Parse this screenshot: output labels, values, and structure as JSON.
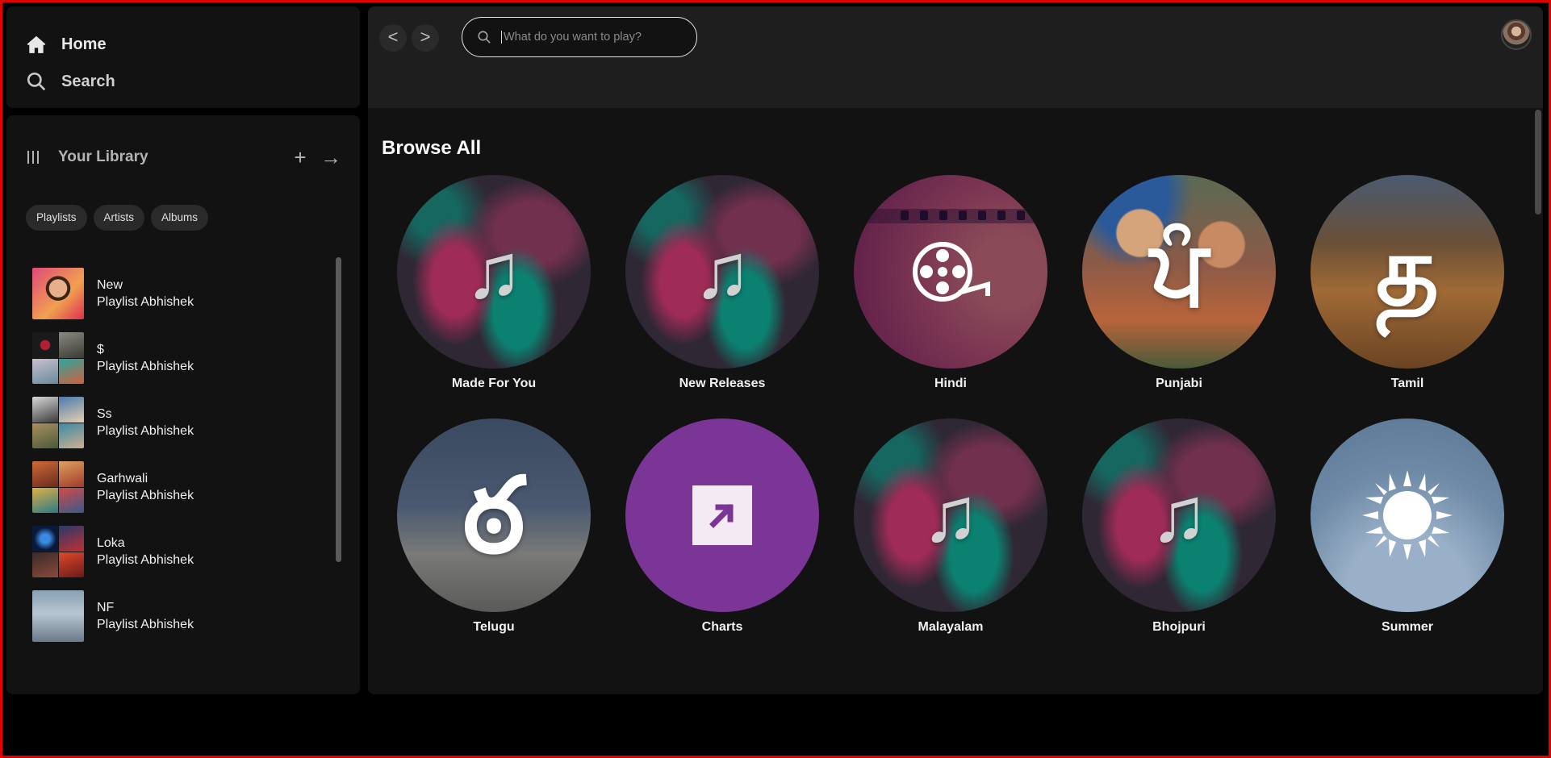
{
  "nav": {
    "home_label": "Home",
    "search_label": "Search"
  },
  "library": {
    "title": "Your Library",
    "add_icon": "+",
    "expand_icon": "→",
    "chips": [
      "Playlists",
      "Artists",
      "Albums"
    ],
    "items": [
      {
        "name": "New",
        "subtitle": "Playlist Abhishek"
      },
      {
        "name": "$",
        "subtitle": "Playlist Abhishek"
      },
      {
        "name": "Ss",
        "subtitle": "Playlist Abhishek"
      },
      {
        "name": "Garhwali",
        "subtitle": "Playlist Abhishek"
      },
      {
        "name": "Loka",
        "subtitle": "Playlist Abhishek"
      },
      {
        "name": "NF",
        "subtitle": "Playlist Abhishek"
      }
    ]
  },
  "topbar": {
    "back_label": "<",
    "forward_label": ">",
    "search_placeholder": "What do you want to play?"
  },
  "browse": {
    "title": "Browse All",
    "cards": [
      {
        "label": "Made For You",
        "glyph": "♫"
      },
      {
        "label": "New Releases",
        "glyph": "♫"
      },
      {
        "label": "Hindi",
        "glyph": ""
      },
      {
        "label": "Punjabi",
        "glyph": "ਪੰ"
      },
      {
        "label": "Tamil",
        "glyph": "த"
      },
      {
        "label": "Telugu",
        "glyph": "ఠ"
      },
      {
        "label": "Charts",
        "glyph": ""
      },
      {
        "label": "Malayalam",
        "glyph": "♫"
      },
      {
        "label": "Bhojpuri",
        "glyph": "♫"
      },
      {
        "label": "Summer",
        "glyph": ""
      }
    ]
  },
  "colors": {
    "panel": "#121212",
    "topbar": "#1e1e1e",
    "frame": "#e00000",
    "charts": "#7b3596"
  }
}
